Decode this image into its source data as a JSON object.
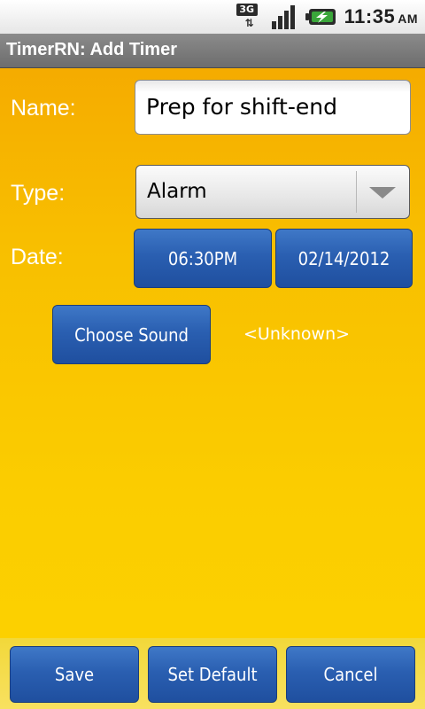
{
  "status_bar": {
    "network": "3G",
    "network_icon": "3g-data-icon",
    "signal_icon": "signal-strength-icon",
    "battery_icon": "battery-charging-icon",
    "time": "11:35",
    "ampm": "AM"
  },
  "title_bar": {
    "title": "TimerRN: Add Timer"
  },
  "form": {
    "name_label": "Name:",
    "name_value": "Prep for shift-end",
    "type_label": "Type:",
    "type_value": "Alarm",
    "date_label": "Date:",
    "time_button": "06:30PM",
    "date_button": "02/14/2012",
    "choose_sound_button": "Choose Sound",
    "sound_value": "<Unknown>"
  },
  "actions": {
    "save": "Save",
    "set_default": "Set Default",
    "cancel": "Cancel"
  },
  "colors": {
    "background_top": "#f4a400",
    "background_bottom": "#fcd200",
    "button_blue": "#2a5fb1",
    "title_bar": "#7b7b7b"
  }
}
